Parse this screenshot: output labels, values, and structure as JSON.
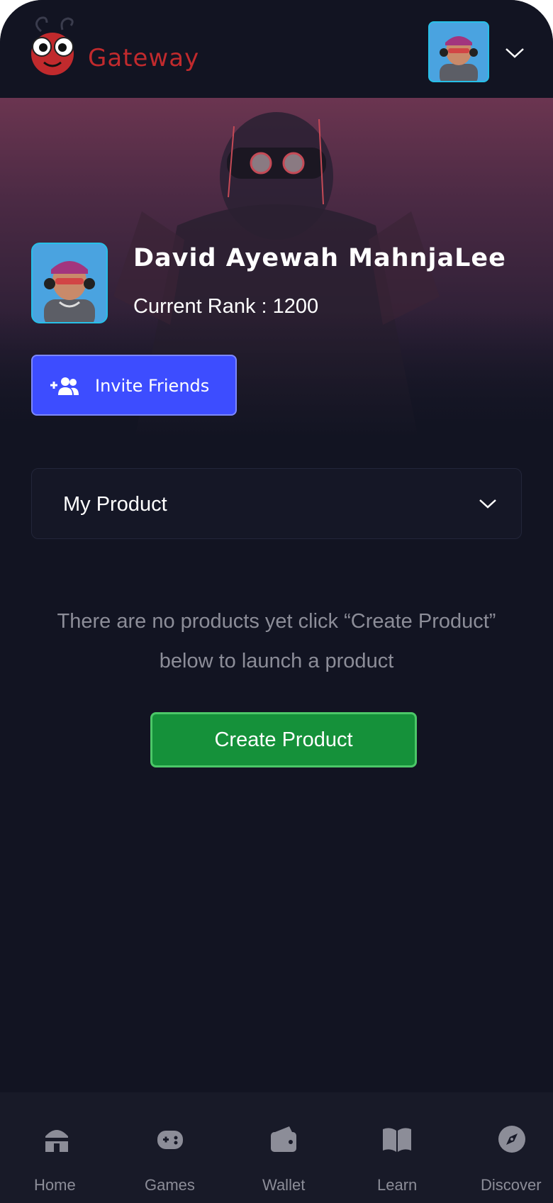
{
  "app": {
    "logo_text": "Gateway"
  },
  "profile": {
    "name": "David Ayewah MahnjaLee",
    "rank_label": "Current Rank : 1200"
  },
  "actions": {
    "invite_label": "Invite Friends",
    "create_label": "Create Product"
  },
  "products": {
    "dropdown_label": "My Product",
    "empty_line1": "There are no products yet click “Create Product”",
    "empty_line2": "below to launch a product"
  },
  "nav": {
    "items": [
      {
        "label": "Home",
        "icon": "home-icon"
      },
      {
        "label": "Games",
        "icon": "gamepad-icon"
      },
      {
        "label": "Wallet",
        "icon": "wallet-icon"
      },
      {
        "label": "Learn",
        "icon": "book-icon"
      },
      {
        "label": "Discover",
        "icon": "compass-icon"
      }
    ]
  },
  "colors": {
    "background": "#121422",
    "accent_blue": "#3d4dff",
    "accent_green": "#15913a",
    "brand_red": "#c12a2d",
    "avatar_border": "#27c0e8"
  }
}
